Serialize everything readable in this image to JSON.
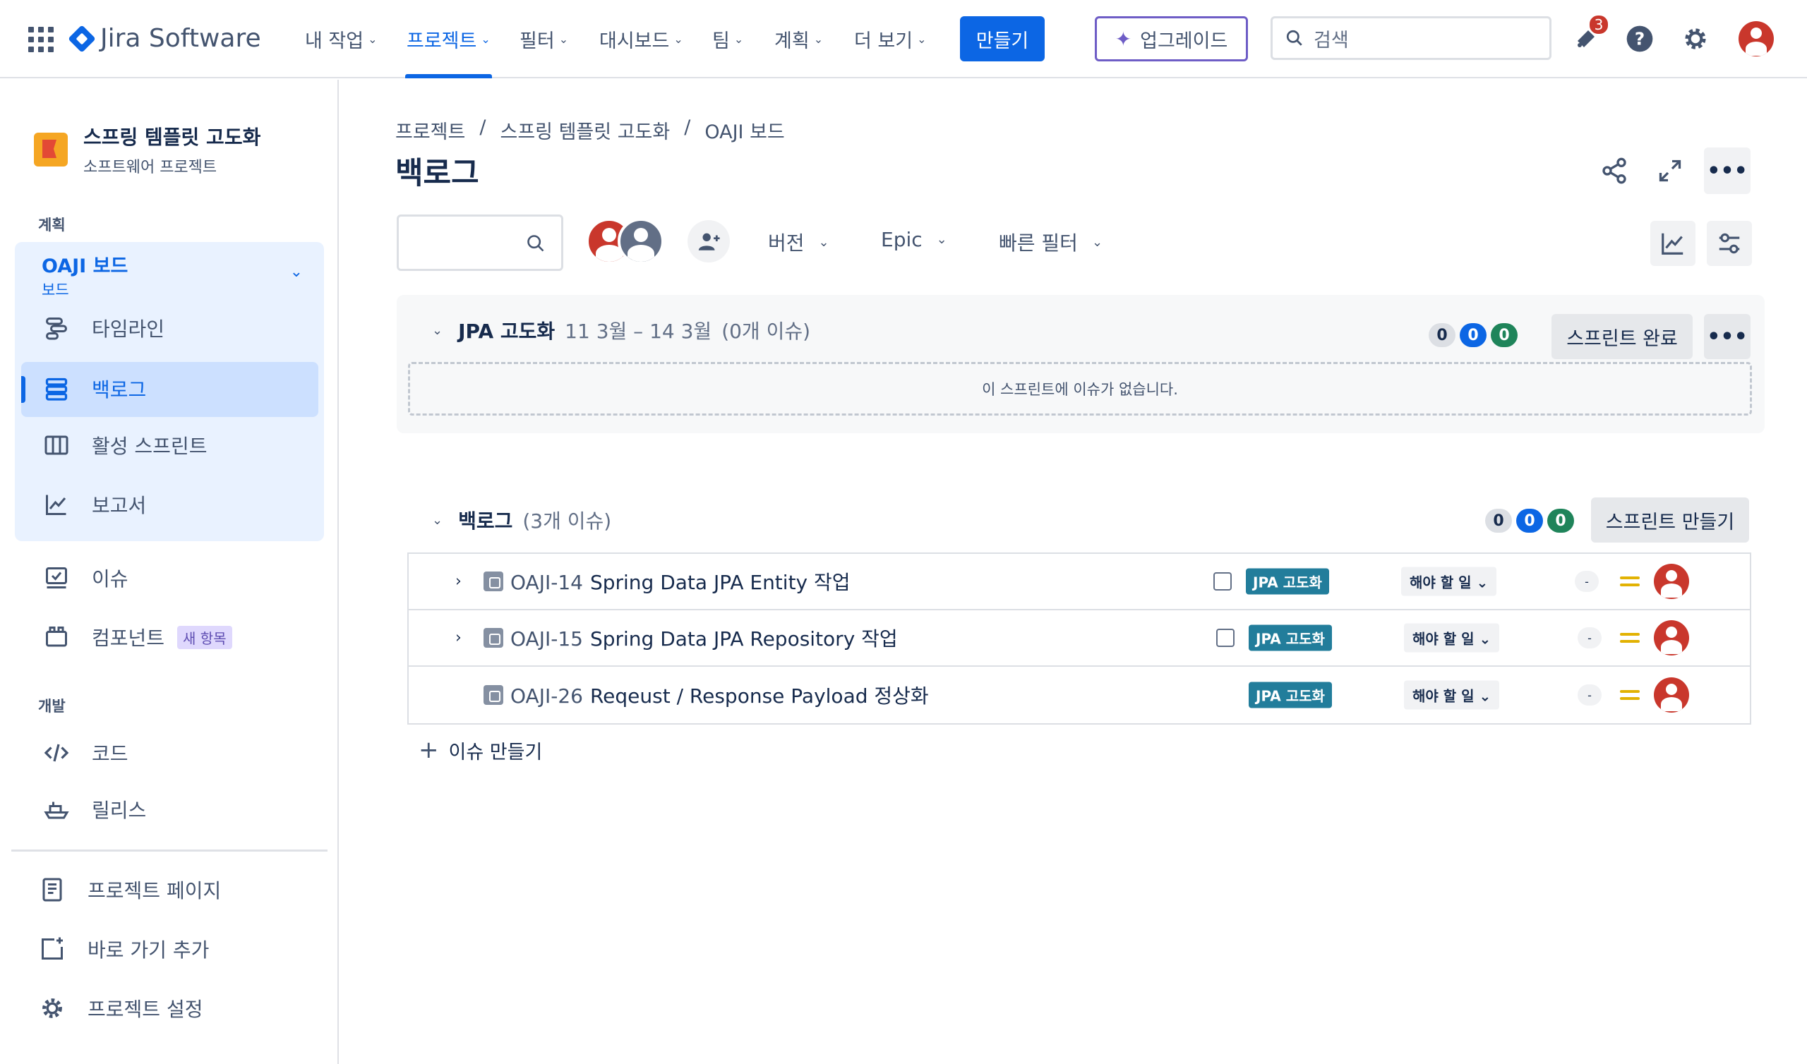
{
  "app": {
    "name": "Jira Software"
  },
  "topnav": {
    "items": [
      {
        "label": "내 작업"
      },
      {
        "label": "프로젝트"
      },
      {
        "label": "필터"
      },
      {
        "label": "대시보드"
      },
      {
        "label": "팀"
      },
      {
        "label": "계획"
      },
      {
        "label": "더 보기"
      }
    ],
    "create_label": "만들기",
    "upgrade_label": "업그레이드",
    "search_placeholder": "검색",
    "notification_count": "3"
  },
  "sidebar": {
    "project_name": "스프링 템플릿 고도화",
    "project_type": "소프트웨어 프로젝트",
    "section_plan": "계획",
    "board_title": "OAJI 보드",
    "board_sub": "보드",
    "board_items": [
      {
        "label": "타임라인"
      },
      {
        "label": "백로그"
      },
      {
        "label": "활성 스프린트"
      },
      {
        "label": "보고서"
      }
    ],
    "items": [
      {
        "label": "이슈"
      },
      {
        "label": "컴포넌트",
        "badge": "새 항목"
      }
    ],
    "section_dev": "개발",
    "dev_items": [
      {
        "label": "코드"
      },
      {
        "label": "릴리스"
      }
    ],
    "bottom_items": [
      {
        "label": "프로젝트 페이지"
      },
      {
        "label": "바로 가기 추가"
      },
      {
        "label": "프로젝트 설정"
      }
    ]
  },
  "breadcrumb": {
    "items": [
      "프로젝트",
      "/",
      "스프링 템플릿 고도화",
      "/",
      "OAJI 보드"
    ]
  },
  "page_title": "백로그",
  "filters": {
    "version_label": "버전",
    "epic_label": "Epic",
    "quick_filter_label": "빠른 필터"
  },
  "sprint": {
    "name": "JPA 고도화",
    "dates": "11 3월 – 14 3월",
    "issue_count": "(0개 이슈)",
    "counts": [
      "0",
      "0",
      "0"
    ],
    "complete_label": "스프린트 완료",
    "empty_text": "이 스프린트에 이슈가 없습니다."
  },
  "backlog": {
    "name": "백로그",
    "issue_count": "(3개 이슈)",
    "counts": [
      "0",
      "0",
      "0"
    ],
    "create_sprint_label": "스프린트 만들기",
    "issues": [
      {
        "key": "OAJI-14",
        "summary": "Spring Data JPA Entity 작업",
        "epic": "JPA 고도화",
        "status": "해야 할 일",
        "estimate": "-"
      },
      {
        "key": "OAJI-15",
        "summary": "Spring Data JPA Repository 작업",
        "epic": "JPA 고도화",
        "status": "해야 할 일",
        "estimate": "-"
      },
      {
        "key": "OAJI-26",
        "summary": "Reqeust / Response Payload 정상화",
        "epic": "JPA 고도화",
        "status": "해야 할 일",
        "estimate": "-"
      }
    ],
    "create_issue_label": "이슈 만들기"
  },
  "colors": {
    "brand": "#0c66e4",
    "epic": "#227d9b",
    "avatar": "#c9372c",
    "priority": "#e2b203"
  }
}
